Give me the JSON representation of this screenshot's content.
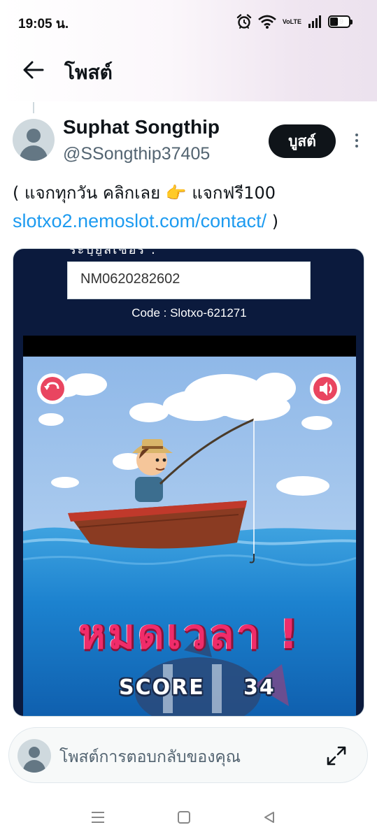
{
  "status_bar": {
    "time": "19:05 น.",
    "volte_top": "Vo",
    "volte_bottom": "LTE",
    "battery": "39",
    "battery_level": 0.39
  },
  "header": {
    "title": "โพสต์"
  },
  "post": {
    "author_name": "Suphat Songthip",
    "author_handle": "@SSongthip37405",
    "boost_label": "บูสต์",
    "text_part1": "( แจกทุกวัน คลิกเลย 👉 แจกฟรี100",
    "link": "slotxo2.nemoslot.com/contact/",
    "text_part2": " )"
  },
  "media": {
    "cut_text": "ระบุยูสเซอร์ :",
    "code_value": "NM0620282602",
    "code_line": "Code : Slotxo-621271",
    "timeout_text": "หมดเวลา !",
    "score_label": "SCORE",
    "score_value": "34"
  },
  "reply": {
    "placeholder": "โพสต์การตอบกลับของคุณ"
  },
  "icons": {
    "back": "arrow-left-icon",
    "more": "more-vertical-icon",
    "expand": "expand-icon",
    "alarm": "alarm-icon",
    "wifi": "wifi-icon",
    "signal": "signal-icon",
    "battery": "battery-icon",
    "nav_menu": "menu-icon",
    "nav_home": "home-square-icon",
    "nav_back": "back-triangle-icon"
  },
  "colors": {
    "link": "#1d9bf0",
    "boost_bg": "#0f1419",
    "timeout": "#f02c6a"
  }
}
